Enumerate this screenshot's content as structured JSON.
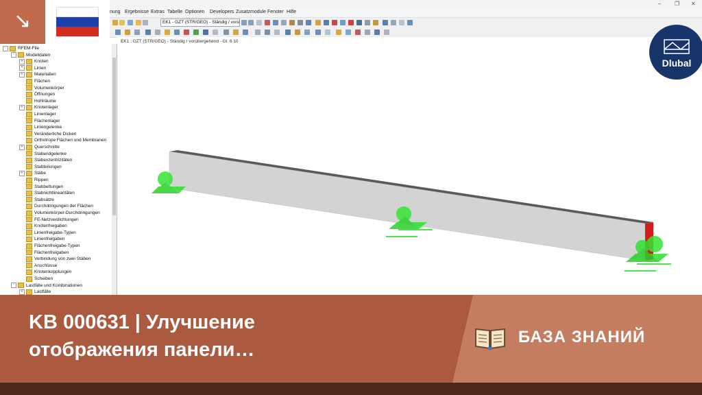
{
  "menu": {
    "items": [
      "nung",
      "Ergebnisse",
      "Extras",
      "Tabelle",
      "Optionen",
      "Developers",
      "Zusatzmodule",
      "Fenster",
      "Hilfe"
    ]
  },
  "toolbar": {
    "loadcase_combo": "EK1 - GZT (STR/GEO) - Ständig / vorübe"
  },
  "navigator": {
    "rows": [
      {
        "label": "RFEM-File",
        "level": 0,
        "exp": "-"
      },
      {
        "label": "Modelldaten",
        "level": 1,
        "exp": "-"
      },
      {
        "label": "Knoten",
        "level": 2,
        "exp": "+"
      },
      {
        "label": "Linien",
        "level": 2,
        "exp": "+"
      },
      {
        "label": "Materialien",
        "level": 2,
        "exp": "+"
      },
      {
        "label": "Flächen",
        "level": 2,
        "exp": ""
      },
      {
        "label": "Volumenkörper",
        "level": 2,
        "exp": ""
      },
      {
        "label": "Öffnungen",
        "level": 2,
        "exp": ""
      },
      {
        "label": "Hohlräume",
        "level": 2,
        "exp": ""
      },
      {
        "label": "Knotenlager",
        "level": 2,
        "exp": "+"
      },
      {
        "label": "Linienlager",
        "level": 2,
        "exp": ""
      },
      {
        "label": "Flächenlager",
        "level": 2,
        "exp": ""
      },
      {
        "label": "Liniengelenke",
        "level": 2,
        "exp": ""
      },
      {
        "label": "Veränderliche Dicken",
        "level": 2,
        "exp": ""
      },
      {
        "label": "Orthotrope Flächen und Membranen",
        "level": 2,
        "exp": ""
      },
      {
        "label": "Querschnitte",
        "level": 2,
        "exp": "+"
      },
      {
        "label": "Stabendgelenke",
        "level": 2,
        "exp": ""
      },
      {
        "label": "Stabexzentrizitäten",
        "level": 2,
        "exp": ""
      },
      {
        "label": "Stabteilungen",
        "level": 2,
        "exp": ""
      },
      {
        "label": "Stäbe",
        "level": 2,
        "exp": "+"
      },
      {
        "label": "Rippen",
        "level": 2,
        "exp": ""
      },
      {
        "label": "Stabbettungen",
        "level": 2,
        "exp": ""
      },
      {
        "label": "Stabnichtlinearitäten",
        "level": 2,
        "exp": ""
      },
      {
        "label": "Stabsätze",
        "level": 2,
        "exp": ""
      },
      {
        "label": "Durchdringungen der Flächen",
        "level": 2,
        "exp": ""
      },
      {
        "label": "Volumenkörper-Durchdringungen",
        "level": 2,
        "exp": ""
      },
      {
        "label": "FE-Netzverdichtungen",
        "level": 2,
        "exp": ""
      },
      {
        "label": "Knotenfreigaben",
        "level": 2,
        "exp": ""
      },
      {
        "label": "Linienfreigabe-Typen",
        "level": 2,
        "exp": ""
      },
      {
        "label": "Linienfreigaben",
        "level": 2,
        "exp": ""
      },
      {
        "label": "Flächenfreigabe-Typen",
        "level": 2,
        "exp": ""
      },
      {
        "label": "Flächenfreigaben",
        "level": 2,
        "exp": ""
      },
      {
        "label": "Verbindung von zwei Stäben",
        "level": 2,
        "exp": ""
      },
      {
        "label": "Anschlüsse",
        "level": 2,
        "exp": ""
      },
      {
        "label": "Knotenkopplungen",
        "level": 2,
        "exp": ""
      },
      {
        "label": "Scheiben",
        "level": 2,
        "exp": ""
      },
      {
        "label": "Lastfälle und Kombinationen",
        "level": 1,
        "exp": "-"
      },
      {
        "label": "Lastfälle",
        "level": 2,
        "exp": "+"
      }
    ]
  },
  "viewport": {
    "header": "EK1 : GZT (STR/GEO) - Ständig / vorübergehend - Gl. 6.10"
  },
  "brand": {
    "logo_text": "Dlubal"
  },
  "banner": {
    "title_line1": "KB 000631 | Улучшение",
    "title_line2": "отображения панели…",
    "category": "БАЗА ЗНАНИЙ"
  },
  "colors": {
    "accent_dark": "#ab5a3f",
    "accent_light": "#c57d62",
    "brand_blue": "#17356b",
    "support_green": "#33e633"
  },
  "icons": {
    "arrow": "arrow-down-right-icon",
    "flag": "russian-flag-icon",
    "book": "open-book-icon"
  }
}
